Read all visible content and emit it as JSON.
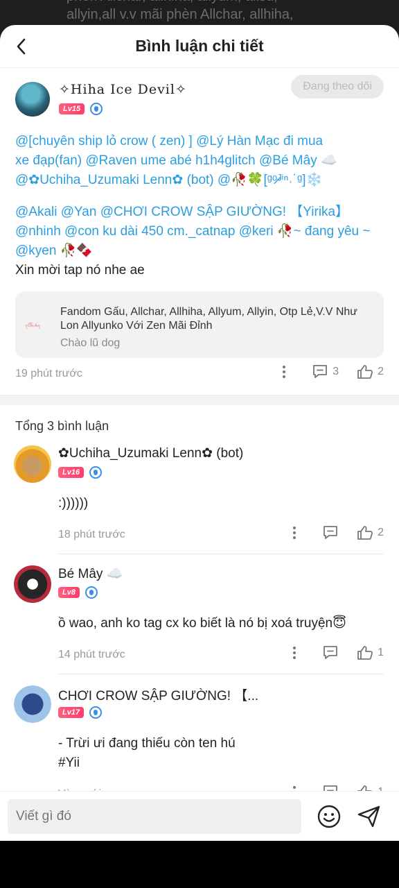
{
  "backdrop": {
    "text": "phèn Allchar, allhiha, allyum, allsu, allyin,all v.v mãi phèn Allchar, allhiha,"
  },
  "header": {
    "title": "Bình luận chi tiết"
  },
  "post": {
    "author": "✧Hiha Ice Devil✧",
    "level": "Lv15",
    "follow_label": "Đang theo dõi",
    "paragraph1": [
      "@[chuyên ship lỏ crow ( zen) ] @Lý Hàn Mạc đi mua",
      "xe đạp(fan) @Raven ume abé h1h4glitch @Bé Mây ☁️",
      "@✿Uchiha_Uzumaki Lenn✿ (bot) @🥀🍀[ᵍᵒ̷ᴶⁱⁿ˒˙ᵍ]❄️"
    ],
    "paragraph2": [
      "@Akali @Yan @CHƠI CROW SẬP GIƯỜNG! 【Yirika】",
      "@nhinh @con ku dài 450 cm._catnap @keri 🥀~ đang yêu ~",
      "@kyen 🥀🍫"
    ],
    "paragraph2_plain": "Xin mời tap nó nhe ae",
    "card": {
      "thumb_text": "ꪖꪶꪶꫝꪱꫝꪖ",
      "title": "Fandom Gấu, Allchar, Allhiha, Allyum, Allyin, Otp Lẻ,V.V Như Lon Allyunko Với Zen Mãi Đỉnh",
      "subtitle": "Chào lũ dog"
    },
    "time": "19 phút trước",
    "comment_count": "3",
    "like_count": "2"
  },
  "comments_section": {
    "total_label": "Tổng 3 bình luận",
    "items": [
      {
        "name": "✿Uchiha_Uzumaki Lenn✿ (bot)",
        "level": "Lv16",
        "text": ":))))))",
        "time": "18 phút trước",
        "likes": "2"
      },
      {
        "name": "Bé Mây ☁️",
        "level": "Lv8",
        "text": "ồ wao, anh ko tag cx ko biết là nó bị xoá truyện😇",
        "time": "14 phút trước",
        "likes": "1"
      },
      {
        "name": "CHƠI CROW SẬP GIƯỜNG! 【...",
        "level": "Lv17",
        "text_lines": [
          "- Trừi ưi đang thiếu còn ten hú",
          "#Yii"
        ],
        "time": "Vừa mới",
        "likes": "1"
      }
    ]
  },
  "input": {
    "placeholder": "Viết gì đó"
  },
  "colors": {
    "mention_blue": "#2a9ee0",
    "level_badge": "#ff3d6a",
    "verified_blue": "#3b8ee8"
  },
  "icons": [
    "back-arrow-icon",
    "more-dots-icon",
    "comment-icon",
    "like-icon",
    "emoji-icon",
    "send-icon",
    "verified-shield-icon"
  ]
}
